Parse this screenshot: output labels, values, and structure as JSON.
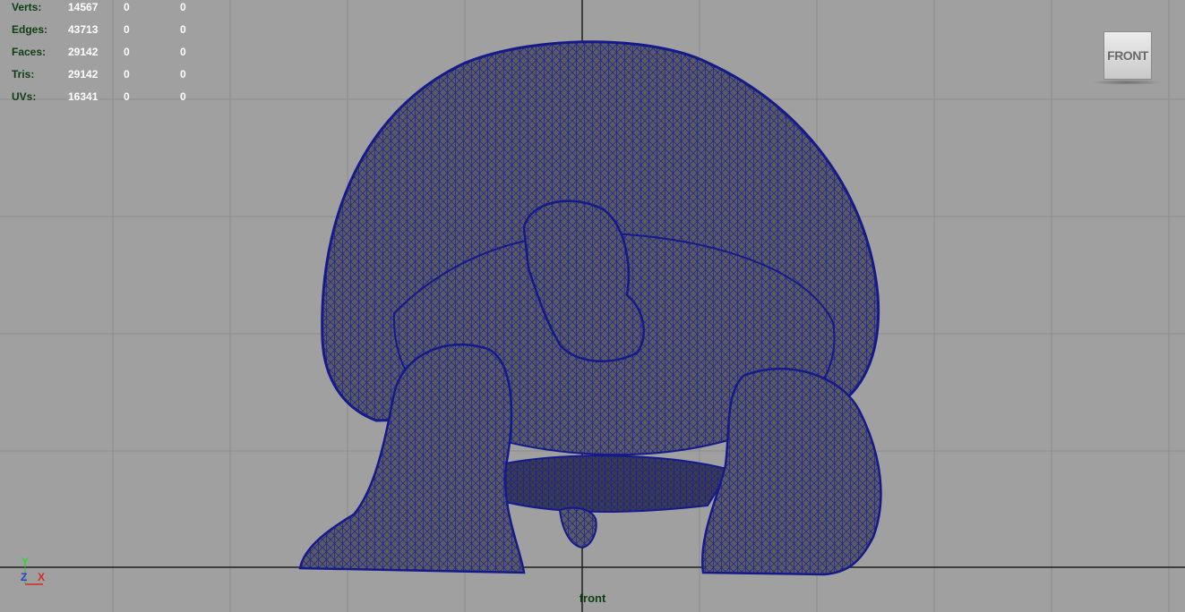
{
  "hud": {
    "rows": [
      {
        "label": "Verts:",
        "v1": "14567",
        "v2": "0",
        "v3": "0"
      },
      {
        "label": "Edges:",
        "v1": "43713",
        "v2": "0",
        "v3": "0"
      },
      {
        "label": "Faces:",
        "v1": "29142",
        "v2": "0",
        "v3": "0"
      },
      {
        "label": "Tris:",
        "v1": "29142",
        "v2": "0",
        "v3": "0"
      },
      {
        "label": "UVs:",
        "v1": "16341",
        "v2": "0",
        "v3": "0"
      }
    ]
  },
  "viewcube": {
    "face_label": "FRONT"
  },
  "axis": {
    "y": "Y",
    "z": "Z",
    "x": "X"
  },
  "camera": {
    "name": "front"
  },
  "colors": {
    "background": "#a0a0a0",
    "grid": "#8c8c8c",
    "axis_line": "#1e1e1e",
    "wireframe": "#141a8a",
    "shade": "#555555",
    "hud_label": "#0e3f12",
    "hud_value": "#ffffff"
  },
  "icons": {
    "viewcube": "view-cube-icon",
    "axis": "axis-gizmo-icon",
    "model": "tortoise-mesh"
  }
}
